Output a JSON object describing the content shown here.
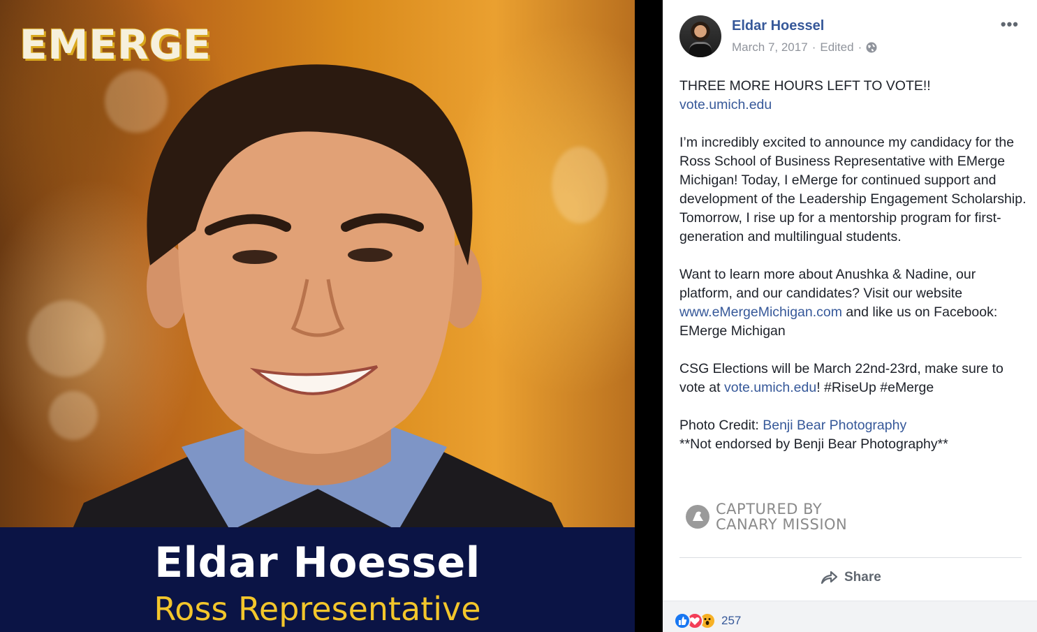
{
  "photo": {
    "logo": "EMERGE",
    "plate_name": "Eldar Hoessel",
    "plate_role": "Ross Representative"
  },
  "post": {
    "author": "Eldar Hoessel",
    "date": "March 7, 2017",
    "edited": "Edited",
    "separator": "·",
    "more_icon": "more-options-icon",
    "body": {
      "p1_text": "THREE MORE HOURS LEFT TO VOTE!!",
      "p1_link": "vote.umich.edu",
      "p2": "I’m incredibly excited to announce my candidacy for the Ross School of Business Representative with EMerge Michigan! Today, I eMerge for continued support and development of the Leadership Engagement Scholarship. Tomorrow, I rise up for a mentorship program for first-generation and multilingual students.",
      "p3_before": "Want to learn more about Anushka & Nadine, our platform, and our candidates? Visit our website ",
      "p3_link": "www.eMergeMichigan.com",
      "p3_after": " and like us on Facebook: EMerge Michigan",
      "p4_before": "CSG Elections will be March 22nd-23rd, make sure to vote at ",
      "p4_link": "vote.umich.edu",
      "p4_after": "! #RiseUp #eMerge",
      "p5_label": "Photo Credit: ",
      "p5_link": "Benji Bear Photography",
      "p5_note": "**Not endorsed by Benji Bear Photography**"
    },
    "watermark_line1": "CAPTURED BY",
    "watermark_line2": "CANARY MISSION",
    "share_label": "Share",
    "reaction_count": "257"
  },
  "colors": {
    "link": "#365899",
    "plate_bg": "#0b1445",
    "plate_role": "#f3c62b",
    "text": "#1d2129",
    "meta": "#90949c"
  }
}
